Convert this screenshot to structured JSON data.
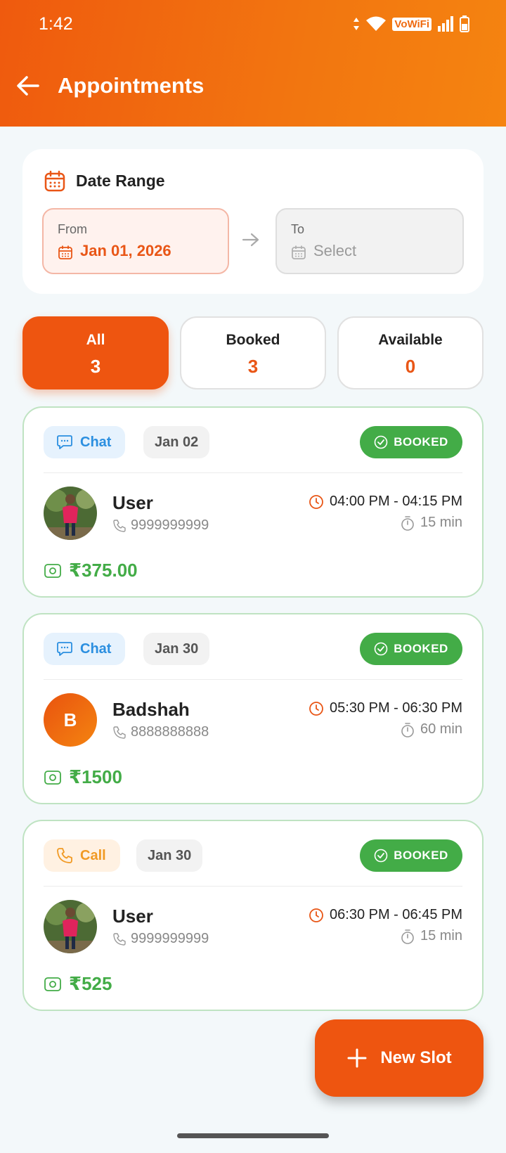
{
  "status_bar": {
    "time": "1:42",
    "vowifi": "VoWiFi"
  },
  "header": {
    "title": "Appointments"
  },
  "date_range": {
    "title": "Date Range",
    "from": {
      "label": "From",
      "value": "Jan 01, 2026"
    },
    "to": {
      "label": "To",
      "placeholder": "Select"
    }
  },
  "filters": [
    {
      "label": "All",
      "count": "3",
      "active": true
    },
    {
      "label": "Booked",
      "count": "3",
      "active": false
    },
    {
      "label": "Available",
      "count": "0",
      "active": false
    }
  ],
  "appointments": [
    {
      "type": "Chat",
      "date": "Jan 02",
      "status": "BOOKED",
      "name": "User",
      "phone": "9999999999",
      "time": "04:00 PM - 04:15 PM",
      "duration": "15 min",
      "price": "₹375.00",
      "avatar": "photo"
    },
    {
      "type": "Chat",
      "date": "Jan 30",
      "status": "BOOKED",
      "name": "Badshah",
      "phone": "8888888888",
      "time": "05:30 PM - 06:30 PM",
      "duration": "60 min",
      "price": "₹1500",
      "avatar_initial": "B"
    },
    {
      "type": "Call",
      "date": "Jan 30",
      "status": "BOOKED",
      "name": "User",
      "phone": "9999999999",
      "time": "06:30 PM - 06:45 PM",
      "duration": "15 min",
      "price": "₹525",
      "avatar": "photo"
    }
  ],
  "fab": {
    "label": "New Slot"
  },
  "colors": {
    "accent": "#ee5510",
    "booked": "#43ac47",
    "chat": "#2b8fe0",
    "call": "#f19a24"
  }
}
